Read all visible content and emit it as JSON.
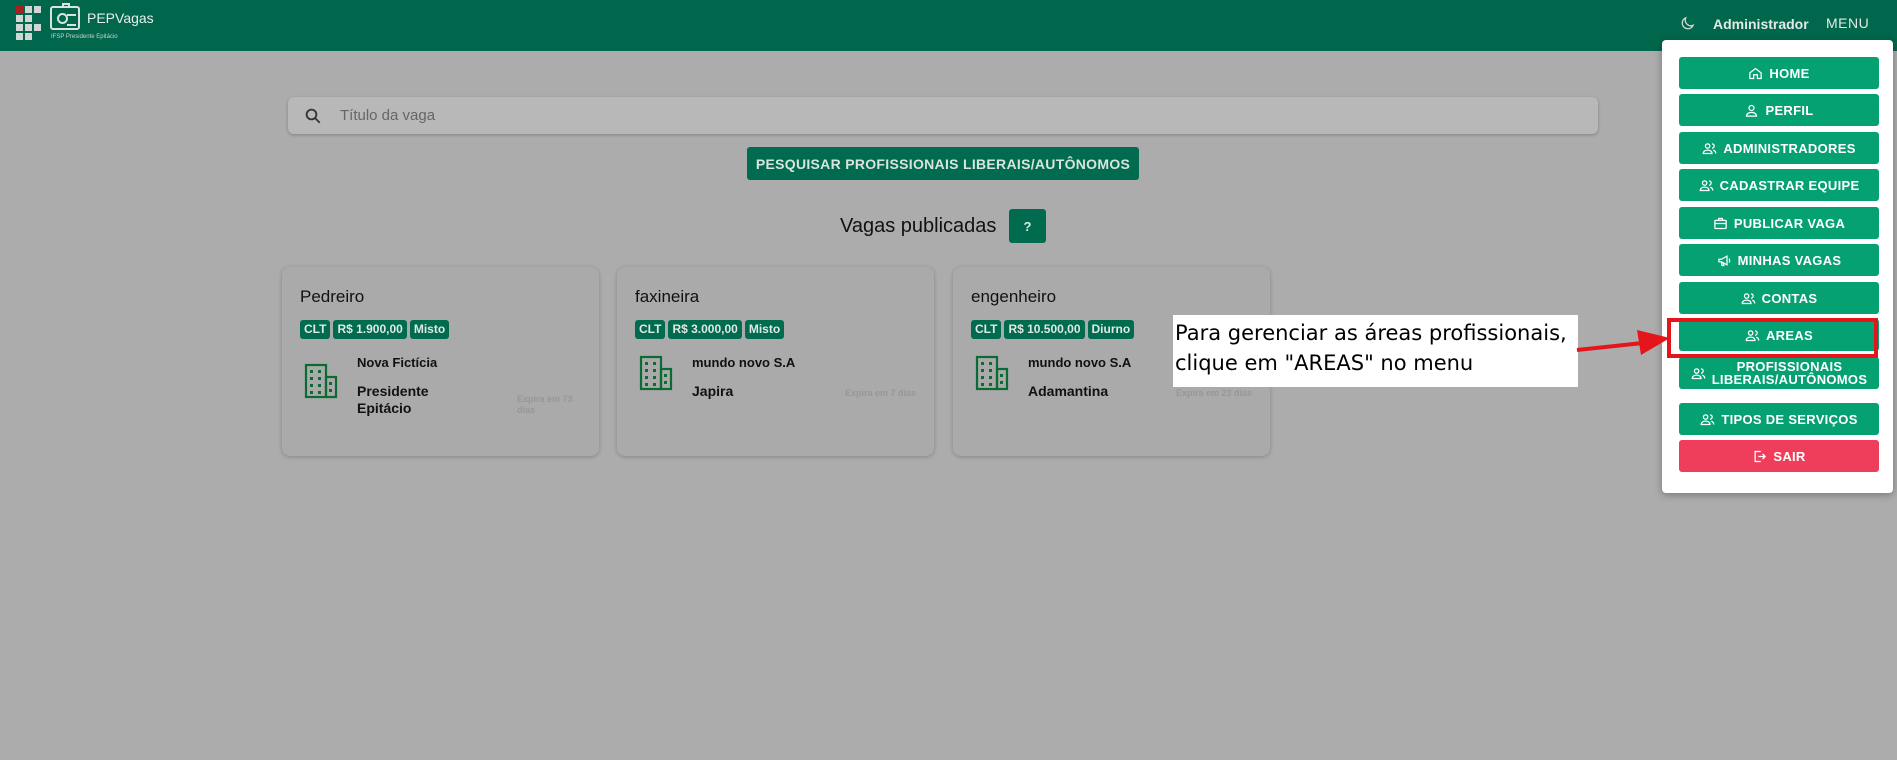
{
  "header": {
    "app_name": "PEPVagas",
    "app_subtitle": "IFSP Presidente Epitácio",
    "user_name": "Administrador",
    "menu_label": "MENU",
    "icons": [
      "moon-icon"
    ]
  },
  "search": {
    "placeholder": "Título da vaga"
  },
  "buttons": {
    "search_professionals": "PESQUISAR PROFISSIONAIS LIBERAIS/AUTÔNOMOS",
    "help": "?"
  },
  "section": {
    "title": "Vagas publicadas"
  },
  "jobs": [
    {
      "title": "Pedreiro",
      "tags": [
        "CLT",
        "R$ 1.900,00",
        "Misto"
      ],
      "company": "Nova Fictícia",
      "city": "Presidente Epitácio",
      "expires": "Expira em 73 dias"
    },
    {
      "title": "faxineira",
      "tags": [
        "CLT",
        "R$ 3.000,00",
        "Misto"
      ],
      "company": "mundo novo S.A",
      "city": "Japira",
      "expires": "Expira em 7 dias"
    },
    {
      "title": "engenheiro",
      "tags": [
        "CLT",
        "R$ 10.500,00",
        "Diurno"
      ],
      "company": "mundo novo S.A",
      "city": "Adamantina",
      "expires": "Expira em 23 dias"
    }
  ],
  "menu": {
    "items": [
      {
        "label": "HOME",
        "icon": "home-icon"
      },
      {
        "label": "PERFIL",
        "icon": "user-icon"
      },
      {
        "label": "ADMINISTRADORES",
        "icon": "users-icon"
      },
      {
        "label": "CADASTRAR EQUIPE",
        "icon": "users-icon"
      },
      {
        "label": "PUBLICAR VAGA",
        "icon": "briefcase-icon"
      },
      {
        "label": "MINHAS VAGAS",
        "icon": "megaphone-icon"
      },
      {
        "label": "CONTAS",
        "icon": "users-icon"
      },
      {
        "label": "AREAS",
        "icon": "users-icon"
      },
      {
        "label_line1": "PROFISSIONAIS",
        "label_line2": "LIBERAIS/AUTÔNOMOS",
        "icon": "users-icon"
      },
      {
        "label": "TIPOS DE SERVIÇOS",
        "icon": "users-icon"
      },
      {
        "label": "SAIR",
        "icon": "logout-icon"
      }
    ]
  },
  "annotation": {
    "line1": "Para gerenciar as áreas profissionais,",
    "line2": "clique em \"AREAS\" no menu"
  },
  "colors": {
    "header_bg": "#00664c",
    "primary_dark": "#006b4f",
    "menu_button": "#06a173",
    "logout_button": "#ef3e5b",
    "highlight_red": "#e5161b"
  }
}
